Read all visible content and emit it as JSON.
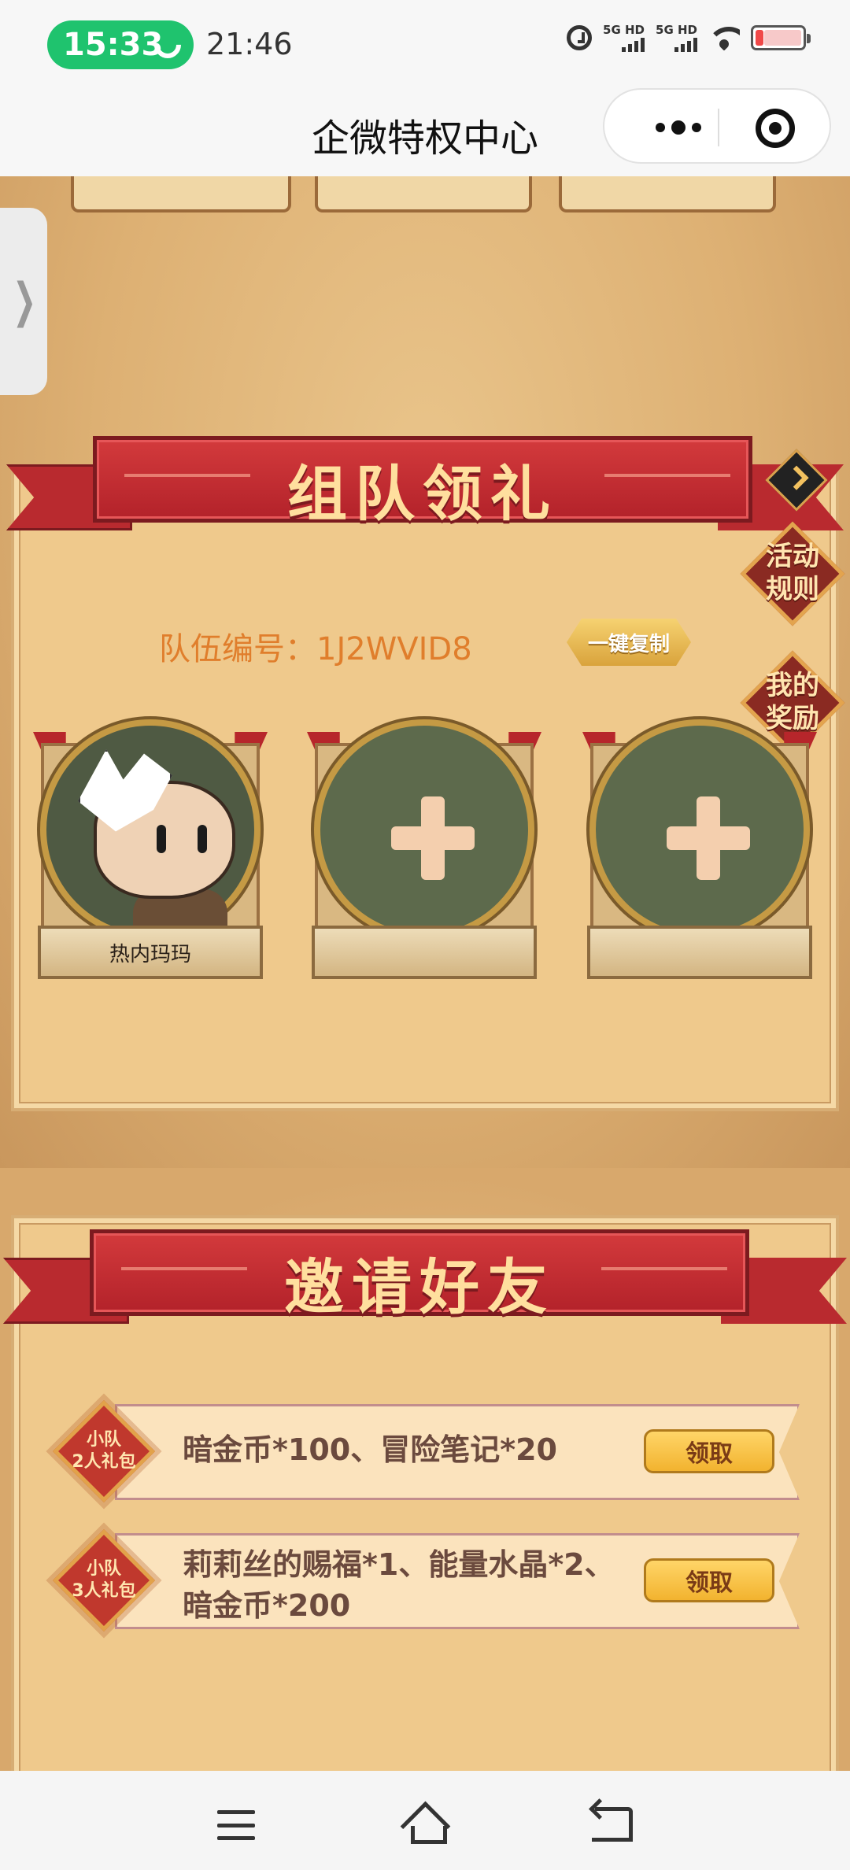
{
  "status_bar": {
    "call_timer": "15:33",
    "clock": "21:46",
    "network_label_1": "5G HD",
    "network_label_2": "5G HD"
  },
  "nav_bar": {
    "title": "企微特权中心"
  },
  "team_section": {
    "banner_title": "组队领礼",
    "rules_label_line1": "活动",
    "rules_label_line2": "规则",
    "rewards_label_line1": "我的",
    "rewards_label_line2": "奖励",
    "team_number_text": "队伍编号：1J2WVID8",
    "copy_button_label": "一键复制",
    "members": [
      {
        "name": "热内玛玛",
        "filled": true
      },
      {
        "name": "",
        "filled": false
      },
      {
        "name": "",
        "filled": false
      }
    ]
  },
  "invite_section": {
    "banner_title": "邀请好友",
    "gifts": [
      {
        "badge_line1": "小队",
        "badge_line2": "2人礼包",
        "description": "暗金币*100、冒险笔记*20",
        "button_label": "领取"
      },
      {
        "badge_line1": "小队",
        "badge_line2": "3人礼包",
        "description": "莉莉丝的赐福*1、能量水晶*2、暗金币*200",
        "button_label": "领取"
      }
    ]
  },
  "colors": {
    "accent_red": "#b3222a",
    "title_gold": "#ffdf9e",
    "team_number_orange": "#e07e2c",
    "claim_yellow": "#f2b32f",
    "call_green": "#1fc36e"
  },
  "icons": {
    "call": "phone-icon",
    "alarm": "alarm-icon",
    "wifi": "wifi-icon",
    "battery": "battery-icon",
    "more": "more-dots-icon",
    "close": "close-target-icon",
    "side_tab": "chevron-right-icon",
    "arrow": "arrow-right-icon",
    "add": "plus-icon",
    "menu": "menu-icon",
    "home": "home-icon",
    "back": "back-icon"
  }
}
